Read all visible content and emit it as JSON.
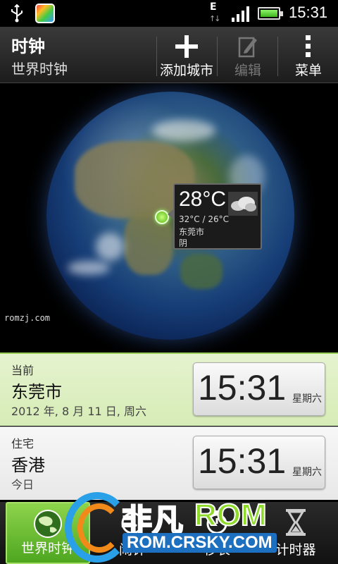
{
  "status_bar": {
    "network": "E",
    "time": "15:31"
  },
  "action_bar": {
    "title": "时钟",
    "subtitle": "世界时钟",
    "add_city": "添加城市",
    "edit": "编辑",
    "menu": "菜单"
  },
  "weather": {
    "temp": "28°C",
    "range": "32°C / 26°C",
    "city": "东莞市",
    "condition": "阴"
  },
  "watermark": "romzj.com",
  "cities": [
    {
      "category": "当前",
      "name": "东莞市",
      "date": "2012 年, 8 月 11 日, 周六",
      "time": "15:31",
      "weekday": "星期六"
    },
    {
      "category": "住宅",
      "name": "香港",
      "date": "今日",
      "time": "15:31",
      "weekday": "星期六"
    }
  ],
  "tabs": [
    {
      "label": "世界时钟"
    },
    {
      "label": "闹钟"
    },
    {
      "label": "秒表"
    },
    {
      "label": "计时器"
    }
  ],
  "overlay": {
    "logo_cn": "非凡",
    "logo_rom": "ROM",
    "logo_url": "ROM.CRSKY.COM"
  },
  "colors": {
    "accent_green": "#6cc23a",
    "current_row_bg": "#e1f0c8"
  }
}
